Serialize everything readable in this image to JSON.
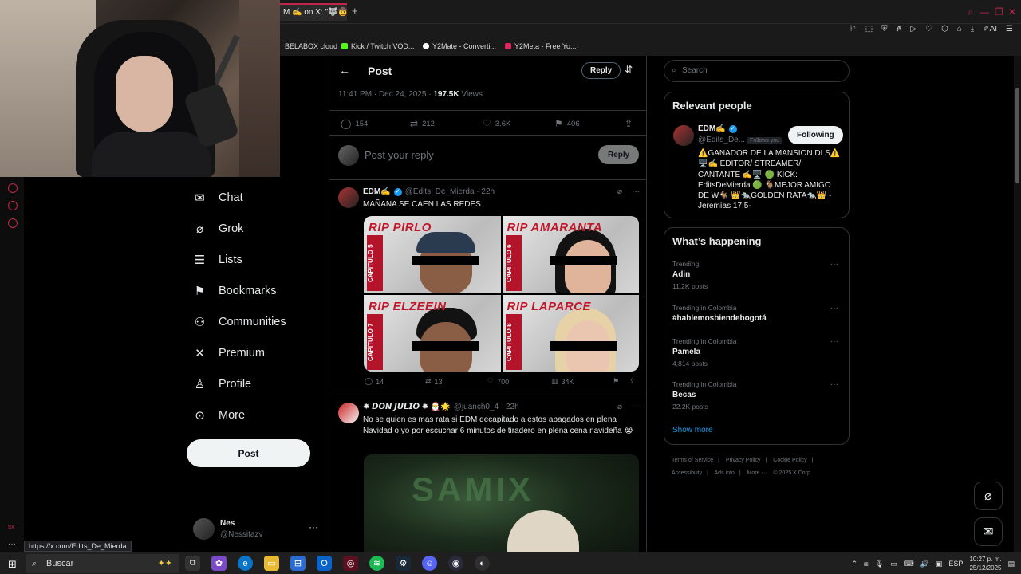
{
  "browser": {
    "tab_title": "M ✍️ on X: \"🐺🤠🎄",
    "bookmarks": [
      {
        "label": "BELABOX cloud",
        "color": "#1a1a1a"
      },
      {
        "label": "Kick / Twitch VOD...",
        "color": "#53fc18"
      },
      {
        "label": "Y2Mate - Converti...",
        "color": "#ffffff"
      },
      {
        "label": "Y2Meta - Free Yo...",
        "color": "#e0245e"
      }
    ],
    "status_url": "https://x.com/Edits_De_Mierda"
  },
  "nav": {
    "items": [
      {
        "label": "Chat",
        "icon": "envelope-icon",
        "glyph": "✉"
      },
      {
        "label": "Grok",
        "icon": "grok-icon",
        "glyph": "⌀"
      },
      {
        "label": "Lists",
        "icon": "list-icon",
        "glyph": "☰"
      },
      {
        "label": "Bookmarks",
        "icon": "bookmark-icon",
        "glyph": "⚑"
      },
      {
        "label": "Communities",
        "icon": "people-icon",
        "glyph": "⚇"
      },
      {
        "label": "Premium",
        "icon": "x-logo-icon",
        "glyph": "✕"
      },
      {
        "label": "Profile",
        "icon": "person-icon",
        "glyph": "♙"
      },
      {
        "label": "More",
        "icon": "more-circle-icon",
        "glyph": "⊙"
      }
    ],
    "post_label": "Post",
    "account": {
      "name": "Nes",
      "handle": "@Nessitazv",
      "more": "···"
    }
  },
  "main": {
    "title": "Post",
    "reply_label": "Reply",
    "timestamp": "11:41 PM · Dec 24, 2025 · ",
    "views_count": "197.5K",
    "views_label": " Views",
    "stats": {
      "replies": "154",
      "reposts": "212",
      "likes": "3.6K",
      "bookmarks": "406"
    },
    "composer_placeholder": "Post your reply",
    "composer_reply": "Reply",
    "tweet1": {
      "name": "EDM✍️",
      "handle": "@Edits_De_Mierda · 22h",
      "text": "MAÑANA SE CAEN LAS REDES",
      "images": [
        {
          "title": "RIP PIRLO",
          "tag": "CAPITULO 5"
        },
        {
          "title": "RIP AMARANTA",
          "tag": "CAPITULO 6"
        },
        {
          "title": "RIP ELZEEIN",
          "tag": "CAPITULO 7"
        },
        {
          "title": "RIP LAPARCE",
          "tag": "CAPITULO 8"
        }
      ],
      "stats": {
        "replies": "14",
        "reposts": "13",
        "likes": "700",
        "views": "34K"
      }
    },
    "tweet2": {
      "name": "✸ 𝘿𝙊𝙉 𝙅𝙐𝙇𝙄𝙊 ✸ 🎅🌟",
      "handle": "@juanch0_4 · 22h",
      "text": "No se quien es mas rata si EDM decapitado a estos apagados en plena Navidad o yo por escuchar 6 minutos de tiradero en plena cena navideña 😭",
      "video_graffiti": "SAMIX"
    }
  },
  "right": {
    "search_placeholder": "Search",
    "relevant_title": "Relevant people",
    "relevant": {
      "name": "EDM✍️",
      "handle": "@Edits_De...",
      "follows_you": "Follows you",
      "follow_label": "Following",
      "bio": "⚠️GANADOR DE LA MANSION DLS⚠️ 🖥️✍️ EDITOR/ STREAMER/ CANTANTE ✍️🖥️ 🟢 KICK: EditsDeMierda 🟢 🐐MEJOR AMIGO DE W🐐 👑🐀GOLDEN RATA🐀👑 - Jeremías 17:5-"
    },
    "happening_title": "What’s happening",
    "trends": [
      {
        "context": "Trending",
        "topic": "Adin",
        "count": "11.2K posts"
      },
      {
        "context": "Trending in Colombia",
        "topic": "#hablemosbiendebogotá",
        "count": ""
      },
      {
        "context": "Trending in Colombia",
        "topic": "Pamela",
        "count": "4,814 posts"
      },
      {
        "context": "Trending in Colombia",
        "topic": "Becas",
        "count": "22.2K posts"
      }
    ],
    "show_more": "Show more",
    "footer": [
      "Terms of Service",
      "|",
      "Privacy Policy",
      "|",
      "Cookie Policy",
      "|",
      "Accessibility",
      "|",
      "Ads info",
      "|",
      "More ···",
      "© 2025 X Corp."
    ]
  },
  "taskbar": {
    "search_placeholder": "Buscar",
    "lang": "ESP",
    "time": "10:27 p. m.",
    "date": "25/12/2025"
  },
  "colors": {
    "accent": "#1d9bf0",
    "obs_red": "#c2264a"
  }
}
